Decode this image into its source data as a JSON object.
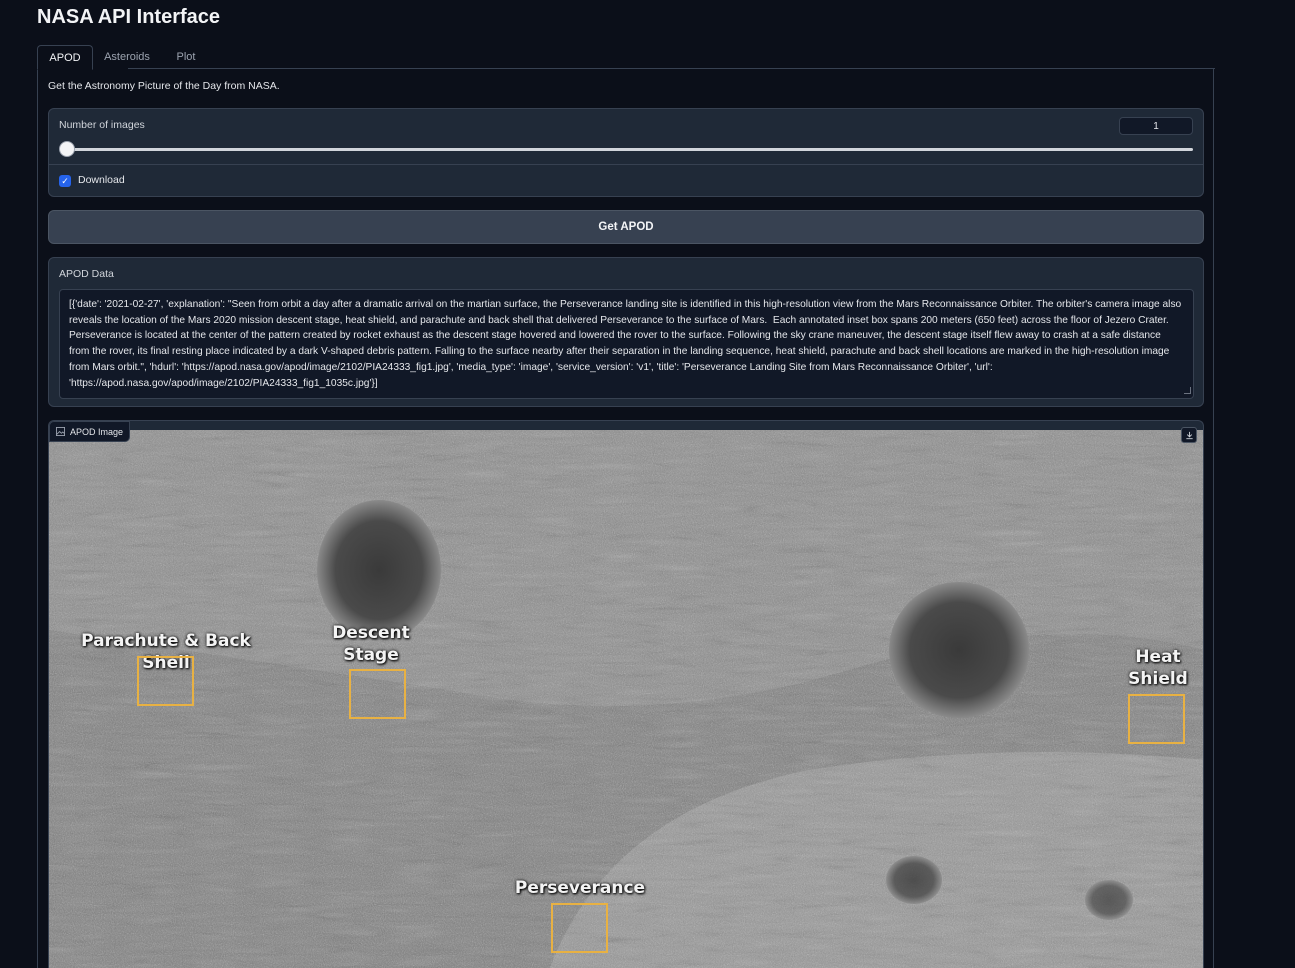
{
  "app": {
    "title": "NASA API Interface"
  },
  "tabs": [
    {
      "label": "APOD",
      "active": true
    },
    {
      "label": "Asteroids",
      "active": false
    },
    {
      "label": "Plot",
      "active": false
    }
  ],
  "apod": {
    "description": "Get the Astronomy Picture of the Day from NASA.",
    "slider": {
      "label": "Number of images",
      "value": "1",
      "fraction": 0.0
    },
    "download": {
      "label": "Download",
      "checked": true
    },
    "button_label": "Get APOD",
    "data_label": "APOD Data",
    "data_text": "[{'date': '2021-02-27', 'explanation': \"Seen from orbit a day after a dramatic arrival on the martian surface, the Perseverance landing site is identified in this high-resolution view from the Mars Reconnaissance Orbiter. The orbiter's camera image also reveals the location of the Mars 2020 mission descent stage, heat shield, and parachute and back shell that delivered Perseverance to the surface of Mars.  Each annotated inset box spans 200 meters (650 feet) across the floor of Jezero Crater. Perseverance is located at the center of the pattern created by rocket exhaust as the descent stage hovered and lowered the rover to the surface. Following the sky crane maneuver, the descent stage itself flew away to crash at a safe distance from the rover, its final resting place indicated by a dark V-shaped debris pattern. Falling to the surface nearby after their separation in the landing sequence, heat shield, parachute and back shell locations are marked in the high-resolution image from Mars orbit.\", 'hdurl': 'https://apod.nasa.gov/apod/image/2102/PIA24333_fig1.jpg', 'media_type': 'image', 'service_version': 'v1', 'title': 'Perseverance Landing Site from Mars Reconnaissance Orbiter', 'url': 'https://apod.nasa.gov/apod/image/2102/PIA24333_fig1_1035c.jpg'}]",
    "image_label": "APOD Image",
    "annotations": {
      "parachute": "Parachute & Back Shell",
      "descent_1": "Descent",
      "descent_2": "Stage",
      "heat_1": "Heat",
      "heat_2": "Shield",
      "perseverance": "Perseverance"
    }
  },
  "icons": {
    "image": "image-icon",
    "download": "download-icon",
    "check": "check-icon"
  },
  "colors": {
    "background": "#0b0f19",
    "panel": "#1f2937",
    "accent": "#2563eb",
    "annotation_box": "#e8b143"
  }
}
